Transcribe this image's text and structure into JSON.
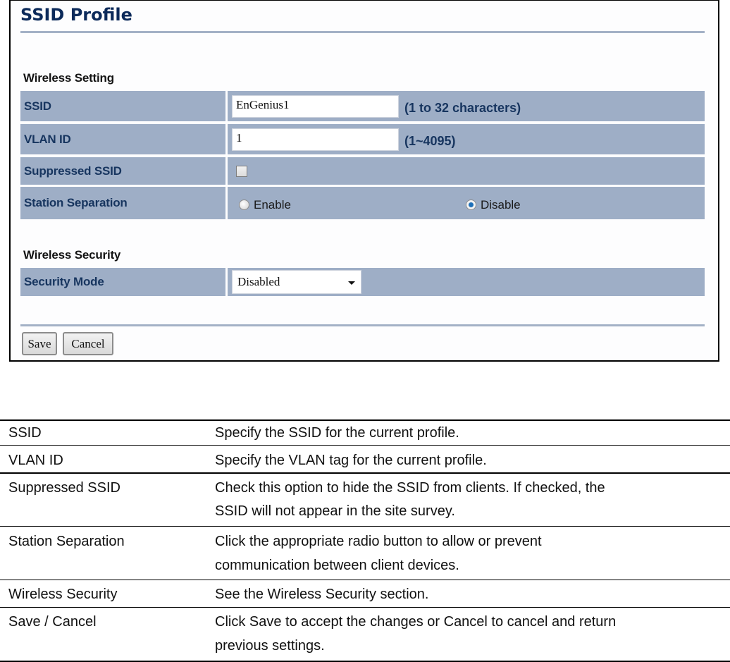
{
  "panel": {
    "title": "SSID Profile",
    "wireless_setting": {
      "heading": "Wireless Setting",
      "ssid": {
        "label": "SSID",
        "value": "EnGenius1",
        "hint": "(1 to 32 characters)"
      },
      "vlan": {
        "label": "VLAN ID",
        "value": "1",
        "hint": "(1~4095)"
      },
      "suppressed": {
        "label": "Suppressed SSID",
        "checked": false
      },
      "station_separation": {
        "label": "Station Separation",
        "options": [
          {
            "label": "Enable",
            "selected": false
          },
          {
            "label": "Disable",
            "selected": true
          }
        ]
      }
    },
    "wireless_security": {
      "heading": "Wireless Security",
      "security_mode": {
        "label": "Security Mode",
        "value": "Disabled"
      }
    },
    "buttons": {
      "save": "Save",
      "cancel": "Cancel"
    }
  },
  "description_table": [
    {
      "term": "SSID",
      "definition": [
        "Specify the SSID for the current profile."
      ]
    },
    {
      "term": "VLAN ID",
      "definition": [
        "Specify the VLAN tag for the current profile."
      ]
    },
    {
      "term": "Suppressed SSID",
      "definition": [
        "Check this option  to hide the SSID from  clients. If checked, the",
        "SSID will not appear in the site survey."
      ]
    },
    {
      "term": "Station Separation",
      "definition": [
        "Click the appropriate radio button  to allow or prevent",
        "communication  between client devices."
      ]
    },
    {
      "term": "Wireless Security",
      "definition": [
        "See the Wireless Security section."
      ]
    },
    {
      "term": "Save / Cancel",
      "definition": [
        "Click Save to accept the changes or Cancel to cancel and return",
        "previous settings."
      ]
    }
  ],
  "colors": {
    "row_bg": "#9eaec6",
    "label_text": "#17355f",
    "title_text": "#0c2a5a",
    "rule": "#a3b1c6"
  }
}
